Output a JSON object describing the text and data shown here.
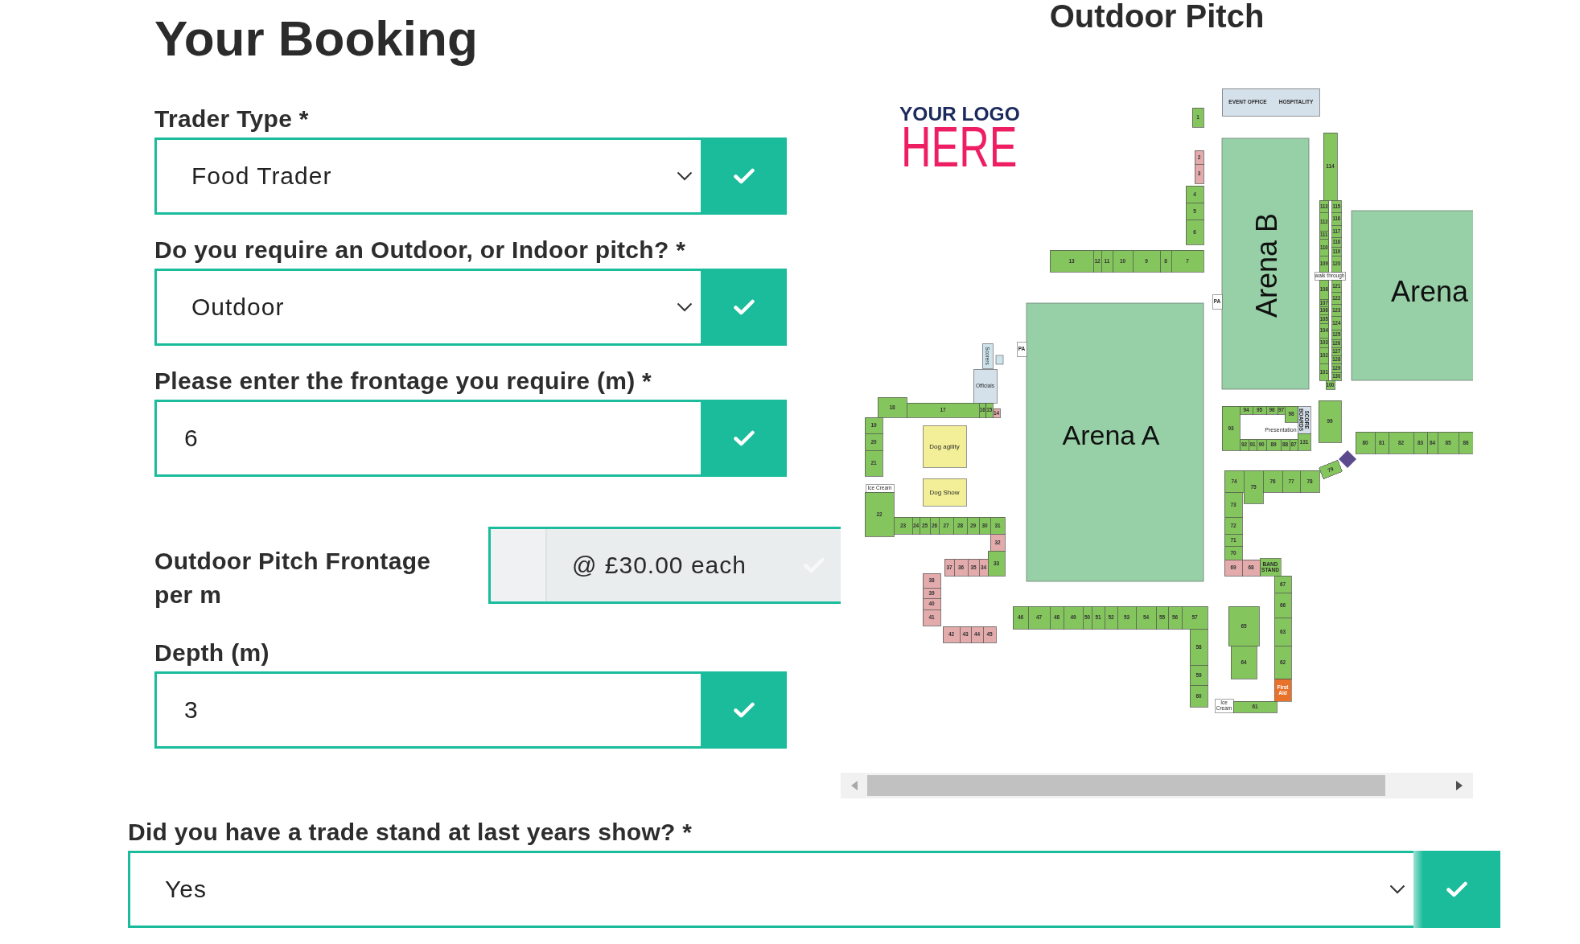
{
  "title": "Your Booking",
  "fields": [
    {
      "kind": "select",
      "label": "Trader Type *",
      "value": "Food Trader",
      "valid": true
    },
    {
      "kind": "select",
      "label": "Do you require an Outdoor, or Indoor pitch? *",
      "value": "Outdoor",
      "valid": true
    },
    {
      "kind": "input",
      "label": "Please enter the frontage you require (m) *",
      "value": "6",
      "valid": true
    },
    {
      "kind": "price",
      "label": "Outdoor Pitch Frontage per m",
      "value": "@ £30.00 each",
      "valid": true
    },
    {
      "kind": "input",
      "label": "Depth (m)",
      "value": "3",
      "valid": true
    }
  ],
  "outdoor_pitch": {
    "title": "Outdoor Pitch",
    "map": {
      "logo": {
        "top": "YOUR LOGO",
        "bottom": "HERE"
      },
      "arenas": [
        {
          "label": "Arena A"
        },
        {
          "label": "Arena B"
        },
        {
          "label": "Arena"
        }
      ],
      "facilities": [
        {
          "labels": [
            "EVENT OFFICE",
            "HOSPITALITY"
          ],
          "color": "#d4e0ea"
        },
        {
          "labels": [
            "walk through"
          ]
        },
        {
          "labels": [
            "PA"
          ]
        },
        {
          "labels": [
            "Scorers"
          ],
          "color": "#cfe3ec"
        },
        {
          "labels": [
            "PA"
          ]
        },
        {
          "labels": [
            "Officials"
          ],
          "color": "#d4e0ea"
        },
        {
          "labels": [
            "Dog agility"
          ],
          "color": "#f3ef98"
        },
        {
          "labels": [
            "Presentation"
          ]
        },
        {
          "labels": [
            "SCORE BOARDS"
          ],
          "color": "#d4e0ea"
        },
        {
          "labels": [
            "Ice Cream"
          ]
        },
        {
          "labels": [
            "Dog Show"
          ],
          "color": "#f3ef98"
        },
        {
          "labels": [
            "BAND STAND"
          ],
          "color": "#85c55e"
        },
        {
          "labels": [
            "Ice Cream"
          ]
        },
        {
          "labels": [
            "First Aid"
          ],
          "color": "#e8722a"
        }
      ],
      "pitches": [
        {
          "label": "1",
          "color": "#85c55e"
        },
        {
          "label": "2",
          "color": "#e3abab"
        },
        {
          "label": "3",
          "color": "#e3abab"
        },
        {
          "label": "4",
          "color": "#85c55e"
        },
        {
          "label": "5",
          "color": "#85c55e"
        },
        {
          "label": "6",
          "color": "#85c55e"
        },
        {
          "label": "13",
          "color": "#85c55e"
        },
        {
          "label": "12",
          "color": "#85c55e"
        },
        {
          "label": "11",
          "color": "#85c55e"
        },
        {
          "label": "10",
          "color": "#85c55e"
        },
        {
          "label": "9",
          "color": "#85c55e"
        },
        {
          "label": "8",
          "color": "#85c55e"
        },
        {
          "label": "7",
          "color": "#85c55e"
        },
        {
          "label": "114",
          "color": "#85c55e"
        },
        {
          "label": "113",
          "color": "#85c55e"
        },
        {
          "label": "112",
          "color": "#85c55e"
        },
        {
          "label": "111",
          "color": "#85c55e"
        },
        {
          "label": "110",
          "color": "#85c55e"
        },
        {
          "label": "109",
          "color": "#85c55e"
        },
        {
          "label": "108",
          "color": "#85c55e"
        },
        {
          "label": "107",
          "color": "#85c55e"
        },
        {
          "label": "106",
          "color": "#85c55e"
        },
        {
          "label": "105",
          "color": "#85c55e"
        },
        {
          "label": "104",
          "color": "#85c55e"
        },
        {
          "label": "103",
          "color": "#85c55e"
        },
        {
          "label": "102",
          "color": "#85c55e"
        },
        {
          "label": "101",
          "color": "#85c55e"
        },
        {
          "label": "115",
          "color": "#85c55e"
        },
        {
          "label": "116",
          "color": "#85c55e"
        },
        {
          "label": "117",
          "color": "#85c55e"
        },
        {
          "label": "118",
          "color": "#85c55e"
        },
        {
          "label": "119",
          "color": "#85c55e"
        },
        {
          "label": "120",
          "color": "#85c55e"
        },
        {
          "label": "121",
          "color": "#85c55e"
        },
        {
          "label": "122",
          "color": "#85c55e"
        },
        {
          "label": "123",
          "color": "#85c55e"
        },
        {
          "label": "124",
          "color": "#85c55e"
        },
        {
          "label": "125",
          "color": "#85c55e"
        },
        {
          "label": "126",
          "color": "#85c55e"
        },
        {
          "label": "127",
          "color": "#85c55e"
        },
        {
          "label": "128",
          "color": "#85c55e"
        },
        {
          "label": "129",
          "color": "#85c55e"
        },
        {
          "label": "130",
          "color": "#85c55e"
        },
        {
          "label": "100",
          "color": "#85c55e"
        },
        {
          "label": "18",
          "color": "#85c55e"
        },
        {
          "label": "17",
          "color": "#85c55e"
        },
        {
          "label": "16",
          "color": "#85c55e"
        },
        {
          "label": "15",
          "color": "#85c55e"
        },
        {
          "label": "14",
          "color": "#e3abab"
        },
        {
          "label": "19",
          "color": "#85c55e"
        },
        {
          "label": "20",
          "color": "#85c55e"
        },
        {
          "label": "21",
          "color": "#85c55e"
        },
        {
          "label": "22",
          "color": "#85c55e"
        },
        {
          "label": "23",
          "color": "#85c55e"
        },
        {
          "label": "24",
          "color": "#85c55e"
        },
        {
          "label": "25",
          "color": "#85c55e"
        },
        {
          "label": "26",
          "color": "#85c55e"
        },
        {
          "label": "27",
          "color": "#85c55e"
        },
        {
          "label": "28",
          "color": "#85c55e"
        },
        {
          "label": "29",
          "color": "#85c55e"
        },
        {
          "label": "30",
          "color": "#85c55e"
        },
        {
          "label": "31",
          "color": "#85c55e"
        },
        {
          "label": "32",
          "color": "#e3abab"
        },
        {
          "label": "38",
          "color": "#e3abab"
        },
        {
          "label": "39",
          "color": "#e3abab"
        },
        {
          "label": "40",
          "color": "#e3abab"
        },
        {
          "label": "41",
          "color": "#e3abab"
        },
        {
          "label": "37",
          "color": "#e3abab"
        },
        {
          "label": "36",
          "color": "#e3abab"
        },
        {
          "label": "35",
          "color": "#e3abab"
        },
        {
          "label": "34",
          "color": "#e3abab"
        },
        {
          "label": "33",
          "color": "#85c55e"
        },
        {
          "label": "42",
          "color": "#e3abab"
        },
        {
          "label": "43",
          "color": "#e3abab"
        },
        {
          "label": "44",
          "color": "#e3abab"
        },
        {
          "label": "45",
          "color": "#e3abab"
        },
        {
          "label": "46",
          "color": "#85c55e"
        },
        {
          "label": "47",
          "color": "#85c55e"
        },
        {
          "label": "48",
          "color": "#85c55e"
        },
        {
          "label": "49",
          "color": "#85c55e"
        },
        {
          "label": "50",
          "color": "#85c55e"
        },
        {
          "label": "51",
          "color": "#85c55e"
        },
        {
          "label": "52",
          "color": "#85c55e"
        },
        {
          "label": "53",
          "color": "#85c55e"
        },
        {
          "label": "54",
          "color": "#85c55e"
        },
        {
          "label": "55",
          "color": "#85c55e"
        },
        {
          "label": "56",
          "color": "#85c55e"
        },
        {
          "label": "57",
          "color": "#85c55e"
        },
        {
          "label": "58",
          "color": "#85c55e"
        },
        {
          "label": "59",
          "color": "#85c55e"
        },
        {
          "label": "60",
          "color": "#85c55e"
        },
        {
          "label": "93",
          "color": "#85c55e"
        },
        {
          "label": "94",
          "color": "#85c55e"
        },
        {
          "label": "95",
          "color": "#85c55e"
        },
        {
          "label": "96",
          "color": "#85c55e"
        },
        {
          "label": "97",
          "color": "#85c55e"
        },
        {
          "label": "98",
          "color": "#85c55e"
        },
        {
          "label": "92",
          "color": "#85c55e"
        },
        {
          "label": "91",
          "color": "#85c55e"
        },
        {
          "label": "90",
          "color": "#85c55e"
        },
        {
          "label": "89",
          "color": "#85c55e"
        },
        {
          "label": "88",
          "color": "#85c55e"
        },
        {
          "label": "87",
          "color": "#85c55e"
        },
        {
          "label": "131",
          "color": "#85c55e"
        },
        {
          "label": "99",
          "color": "#85c55e"
        },
        {
          "label": "80",
          "color": "#85c55e"
        },
        {
          "label": "81",
          "color": "#85c55e"
        },
        {
          "label": "82",
          "color": "#85c55e"
        },
        {
          "label": "83",
          "color": "#85c55e"
        },
        {
          "label": "84",
          "color": "#85c55e"
        },
        {
          "label": "85",
          "color": "#85c55e"
        },
        {
          "label": "86",
          "color": "#85c55e"
        },
        {
          "label": "74",
          "color": "#85c55e"
        },
        {
          "label": "75",
          "color": "#85c55e"
        },
        {
          "label": "76",
          "color": "#85c55e"
        },
        {
          "label": "77",
          "color": "#85c55e"
        },
        {
          "label": "78",
          "color": "#85c55e"
        },
        {
          "label": "79",
          "color": "#85c55e"
        },
        {
          "label": "73",
          "color": "#85c55e"
        },
        {
          "label": "72",
          "color": "#85c55e"
        },
        {
          "label": "71",
          "color": "#85c55e"
        },
        {
          "label": "70",
          "color": "#85c55e"
        },
        {
          "label": "69",
          "color": "#e3abab"
        },
        {
          "label": "68",
          "color": "#e3abab"
        },
        {
          "label": "67",
          "color": "#85c55e"
        },
        {
          "label": "66",
          "color": "#85c55e"
        },
        {
          "label": "63",
          "color": "#85c55e"
        },
        {
          "label": "62",
          "color": "#85c55e"
        },
        {
          "label": "65",
          "color": "#85c55e"
        },
        {
          "label": "64",
          "color": "#85c55e"
        },
        {
          "label": "61",
          "color": "#85c55e"
        }
      ]
    }
  },
  "trade_stand_question": {
    "kind": "select",
    "label": "Did you have a trade stand at last years show? *",
    "value": "Yes",
    "valid": true
  }
}
